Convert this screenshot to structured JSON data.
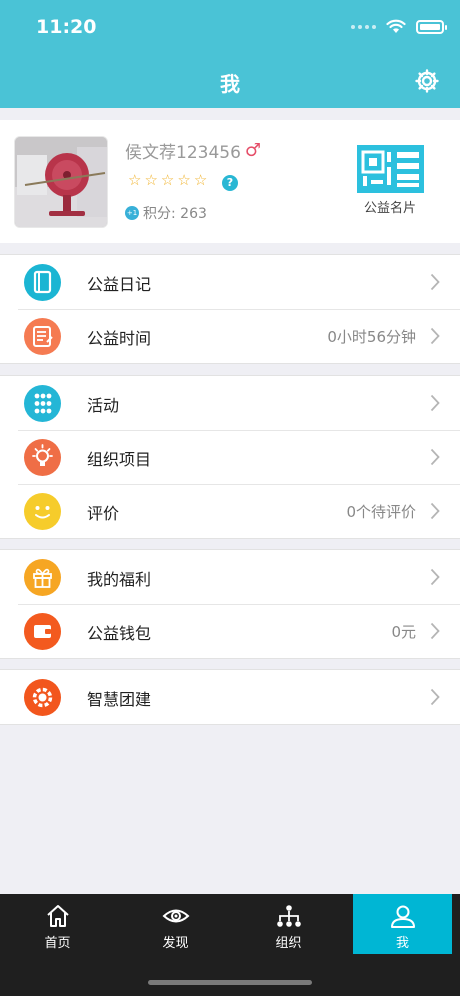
{
  "status_bar": {
    "time": "11:20"
  },
  "header": {
    "title": "我"
  },
  "profile": {
    "username": "侯文荐123456",
    "gender_symbol": "♂",
    "star_rating": 0,
    "points_badge": "+1",
    "points_label": "积分: 263",
    "card_label": "公益名片"
  },
  "menu_groups": [
    {
      "items": [
        {
          "label": "公益日记",
          "value": "",
          "icon": "diary-icon",
          "color": "#1bb5d3"
        },
        {
          "label": "公益时间",
          "value": "0小时56分钟",
          "icon": "timesheet-icon",
          "color": "#f57b52"
        }
      ]
    },
    {
      "items": [
        {
          "label": "活动",
          "value": "",
          "icon": "activity-dots-icon",
          "color": "#24b6d6"
        },
        {
          "label": "组织项目",
          "value": "",
          "icon": "lightbulb-icon",
          "color": "#ef6e46"
        },
        {
          "label": "评价",
          "value": "0个待评价",
          "icon": "smiley-icon",
          "color": "#f6cc2b"
        }
      ]
    },
    {
      "items": [
        {
          "label": "我的福利",
          "value": "",
          "icon": "gift-icon",
          "color": "#f6a623"
        },
        {
          "label": "公益钱包",
          "value": "0元",
          "icon": "wallet-icon",
          "color": "#f35a1f"
        }
      ]
    },
    {
      "items": [
        {
          "label": "智慧团建",
          "value": "",
          "icon": "gear-badge-icon",
          "color": "#f2561d"
        }
      ]
    }
  ],
  "tabbar": {
    "tabs": [
      {
        "label": "首页",
        "icon": "home-icon"
      },
      {
        "label": "发现",
        "icon": "eye-icon"
      },
      {
        "label": "组织",
        "icon": "org-chart-icon"
      },
      {
        "label": "我",
        "icon": "person-icon"
      }
    ],
    "active_index": 3
  }
}
